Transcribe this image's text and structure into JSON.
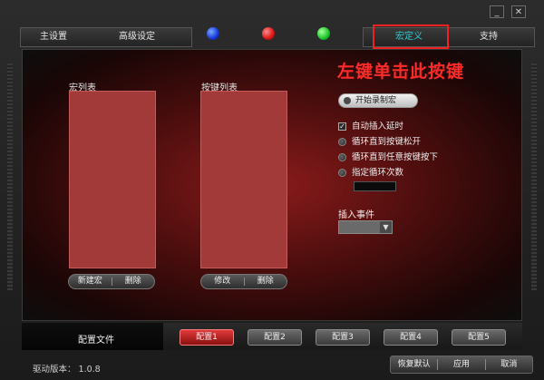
{
  "window": {
    "minimize_icon": "_",
    "close_icon": "✕"
  },
  "tabs": {
    "main": "主设置",
    "advanced": "高级设定",
    "macro": "宏定义",
    "support": "支持"
  },
  "annotation": "左键单击此按键",
  "macro_list": {
    "label": "宏列表",
    "new_label": "新建宏",
    "delete_label": "删除"
  },
  "key_list": {
    "label": "按键列表",
    "edit_label": "修改",
    "delete_label": "删除"
  },
  "record_button": "开始录制宏",
  "options": {
    "auto_insert_delay": "自动插入延时",
    "loop_until_release": "循环直到按键松开",
    "loop_until_any_key": "循环直到任意按键按下",
    "loop_count": "指定循环次数",
    "loop_count_value": ""
  },
  "insert_event": {
    "label": "插入事件",
    "value": ""
  },
  "profile": {
    "label": "配置文件",
    "configs": [
      "配置1",
      "配置2",
      "配置3",
      "配置4",
      "配置5"
    ],
    "active_index": 0
  },
  "footer": {
    "version": "驱动版本： 1.0.8",
    "restore_default": "恢复默认",
    "apply": "应用",
    "cancel": "取消"
  },
  "colors": {
    "accent_cyan": "#2ecfd6",
    "annotation_red": "#ff2a2a",
    "list_fill": "#a33a3a"
  }
}
